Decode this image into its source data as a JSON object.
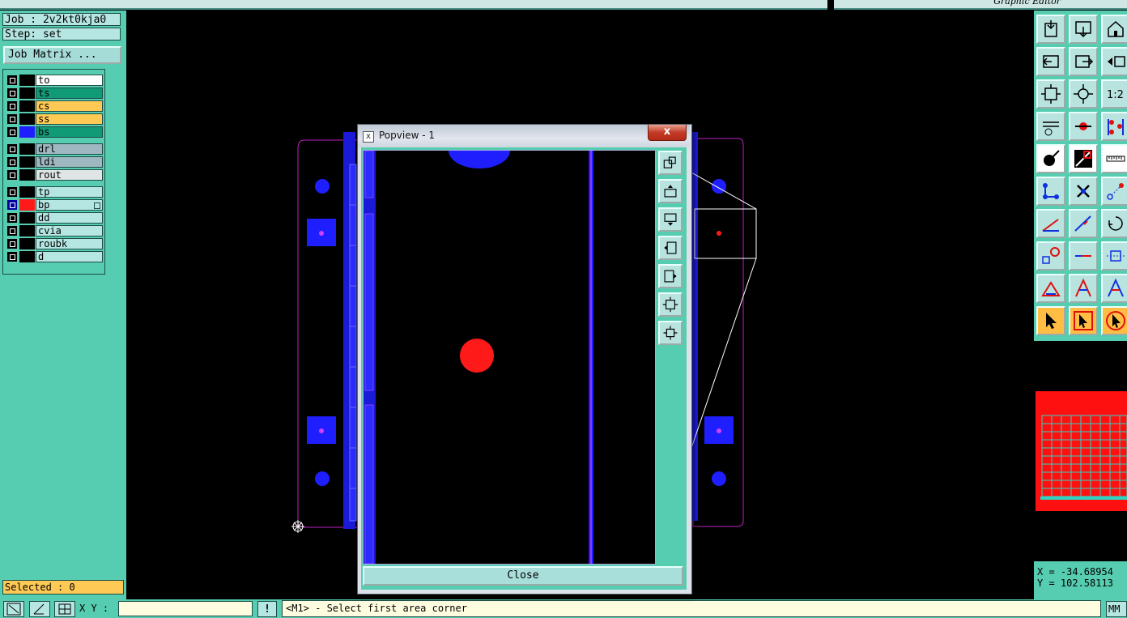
{
  "header": {
    "title": "Graphic Editor"
  },
  "job": {
    "job_line": "Job : 2v2kt0kja0",
    "step_line": "Step: set",
    "matrix_button": "Job Matrix ..."
  },
  "layers": [
    {
      "name": "to",
      "bg": "#ffffff",
      "color": "#000000"
    },
    {
      "name": "ts",
      "bg": "#109a76",
      "color": "#000000"
    },
    {
      "name": "cs",
      "bg": "#ffc955",
      "color": "#000000"
    },
    {
      "name": "ss",
      "bg": "#ffc955",
      "color": "#000000"
    },
    {
      "name": "bs",
      "bg": "#109a76",
      "color": "#1e1eff"
    },
    {
      "name": "drl",
      "bg": "#9fb7c0",
      "color": "#000000"
    },
    {
      "name": "ldi",
      "bg": "#9fb7c0",
      "color": "#000000"
    },
    {
      "name": "rout",
      "bg": "#dfe4e4",
      "color": "#000000"
    },
    {
      "name": "tp",
      "bg": "#b6e6e2",
      "color": "#000000"
    },
    {
      "name": "bp",
      "bg": "#b6e6e2",
      "color": "#ff1a1a"
    },
    {
      "name": "dd",
      "bg": "#b6e6e2",
      "color": "#000000"
    },
    {
      "name": "cvia",
      "bg": "#b6e6e2",
      "color": "#000000"
    },
    {
      "name": "roubk",
      "bg": "#b6e6e2",
      "color": "#000000"
    },
    {
      "name": "d",
      "bg": "#b6e6e2",
      "color": "#000000"
    }
  ],
  "selected": "Selected : 0",
  "popview": {
    "title": "Popview - 1",
    "close_x": "x",
    "close_button": "Close"
  },
  "coords": {
    "x": "X = -34.68954",
    "y": "Y = 102.58113"
  },
  "bottom": {
    "xy_label": "X Y :",
    "xy_value": "",
    "message": "<M1> - Select first area corner",
    "units": "MM",
    "alert": "!"
  },
  "right_tools": [
    "open-job-icon",
    "save-icon",
    "home-icon",
    "step-left-icon",
    "step-right-icon",
    "back-icon",
    "zoom-fit-icon",
    "zoom-center-icon",
    "scale-1-2-icon",
    "measure-tools-icon",
    "snap-icon",
    "layers-route-icon",
    "feature-add-icon",
    "line-draw-icon",
    "ruler-icon",
    "node-edit-icon",
    "delete-icon",
    "move-point-icon",
    "line-red-icon",
    "line-blue-icon",
    "rotate-icon",
    "select-point-icon",
    "split-line-icon",
    "resize-icon",
    "triangle-icon",
    "triangle-a-icon",
    "triangle-a2-icon",
    "select-arrow-icon",
    "select-box-icon",
    "select-lasso-icon"
  ],
  "popview_tools": [
    "zoom-window-icon",
    "page-up-icon",
    "page-down-icon",
    "page-left-icon",
    "page-right-icon",
    "zoom-fit-icon",
    "zoom-in-icon"
  ],
  "colors": {
    "panel": "#56cdb0",
    "pad_blue": "#1e1eff",
    "pad_red": "#ff1a1a",
    "outline_magenta": "#c020c0"
  }
}
